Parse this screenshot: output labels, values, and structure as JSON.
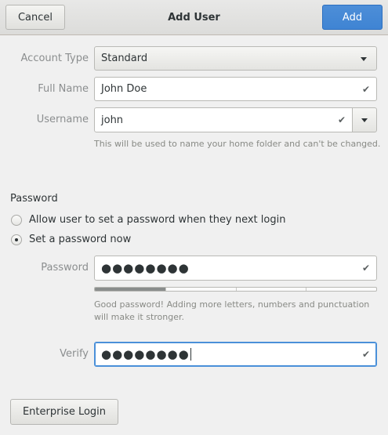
{
  "header": {
    "title": "Add User",
    "cancel_label": "Cancel",
    "add_label": "Add"
  },
  "form": {
    "account_type": {
      "label": "Account Type",
      "value": "Standard"
    },
    "full_name": {
      "label": "Full Name",
      "value": "John Doe"
    },
    "username": {
      "label": "Username",
      "value": "john",
      "hint": "This will be used to name your home folder and can't be changed."
    }
  },
  "password_section": {
    "title": "Password",
    "options": [
      {
        "label": "Allow user to set a password when they next login",
        "selected": false
      },
      {
        "label": "Set a password now",
        "selected": true
      }
    ],
    "password": {
      "label": "Password",
      "value": "●●●●●●●●"
    },
    "strength": {
      "level": 0.25,
      "hint_line1": "Good password! Adding more letters, numbers and punctuation",
      "hint_line2": "will make it stronger."
    },
    "verify": {
      "label": "Verify",
      "value": "●●●●●●●●"
    }
  },
  "footer": {
    "enterprise_label": "Enterprise Login"
  },
  "icons": {
    "check": "✔"
  },
  "colors": {
    "accent": "#4a90d9",
    "add_button": "#4285d4"
  }
}
